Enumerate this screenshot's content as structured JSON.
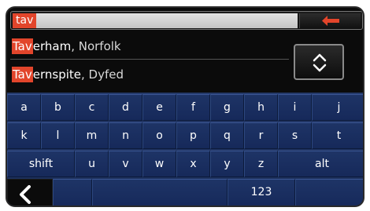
{
  "search": {
    "query": "tav"
  },
  "results": [
    {
      "match": "Tav",
      "rest": "erham",
      "region": ", Norfolk"
    },
    {
      "match": "Tav",
      "rest": "ernspite",
      "region": ", Dyfed"
    }
  ],
  "keyboard": {
    "row1": [
      "a",
      "b",
      "c",
      "d",
      "e",
      "f",
      "g",
      "h",
      "i",
      "j"
    ],
    "row2": [
      "k",
      "l",
      "m",
      "n",
      "o",
      "p",
      "q",
      "r",
      "s",
      "t"
    ],
    "row3": [
      "shift",
      "u",
      "v",
      "w",
      "x",
      "y",
      "z",
      "alt"
    ],
    "row4_mode": "123"
  },
  "icons": {
    "backspace": "left-arrow-icon",
    "scroll": "up-down-chevron-icon",
    "back": "chevron-left-icon"
  },
  "colors": {
    "accent": "#e2452b",
    "keyboard": "#1e3466"
  }
}
